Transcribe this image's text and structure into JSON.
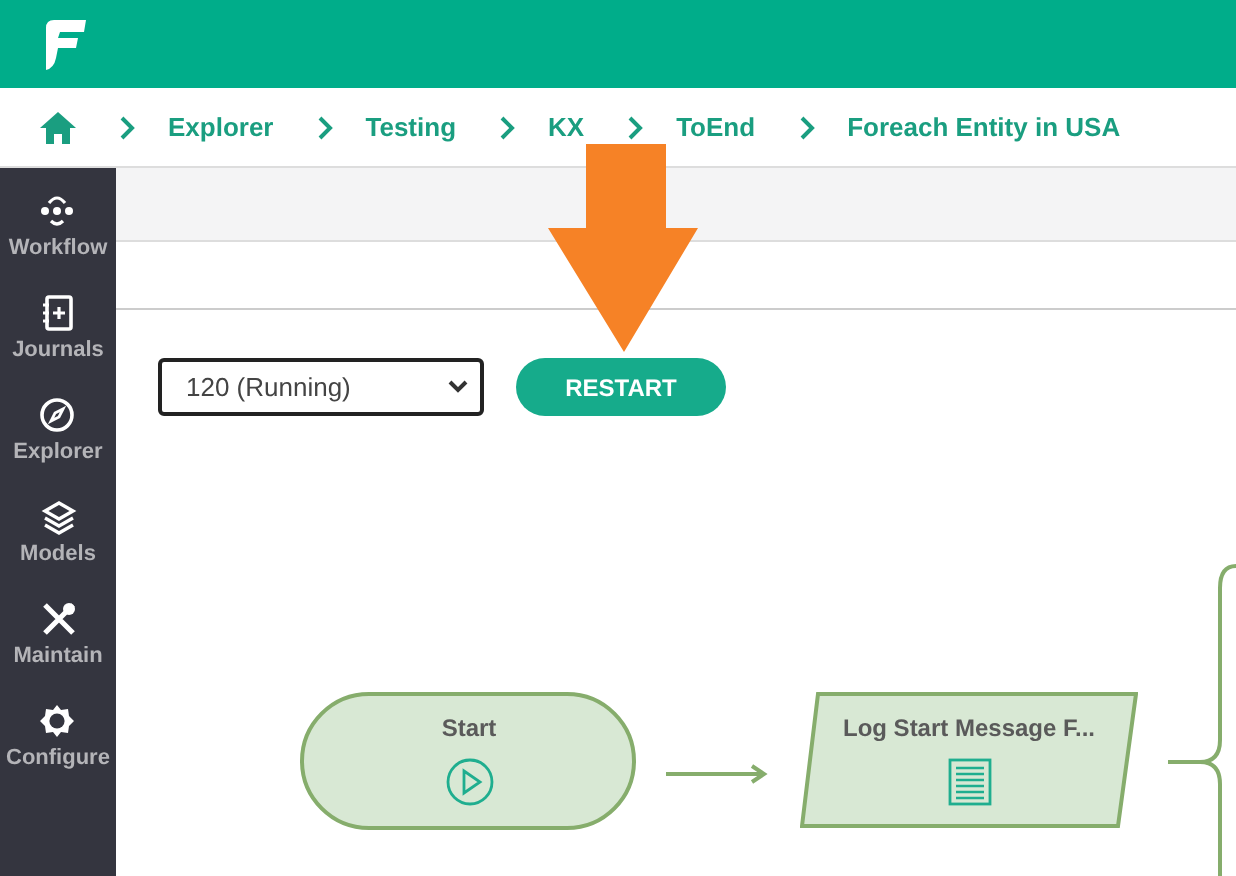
{
  "breadcrumb": [
    {
      "label": "Explorer"
    },
    {
      "label": "Testing"
    },
    {
      "label": "KX"
    },
    {
      "label": "ToEnd"
    },
    {
      "label": "Foreach Entity in USA"
    }
  ],
  "sidebar": {
    "items": [
      {
        "kind": "workflow",
        "label": "Workflow"
      },
      {
        "kind": "journals",
        "label": "Journals"
      },
      {
        "kind": "explorer",
        "label": "Explorer"
      },
      {
        "kind": "models",
        "label": "Models"
      },
      {
        "kind": "maintain",
        "label": "Maintain"
      },
      {
        "kind": "configure",
        "label": "Configure"
      }
    ]
  },
  "run_select": {
    "value": "120 (Running)"
  },
  "restart_button": {
    "label": "RESTART"
  },
  "flow": {
    "nodes": [
      {
        "kind": "start",
        "label": "Start"
      },
      {
        "kind": "log",
        "label": "Log Start Message F..."
      }
    ]
  }
}
